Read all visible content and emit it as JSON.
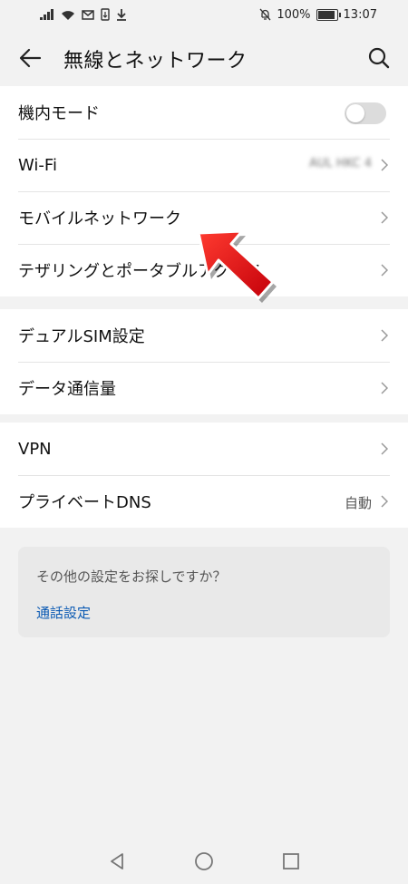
{
  "status_bar": {
    "battery_text": "100%",
    "time": "13:07",
    "battery_level": 1.0
  },
  "header": {
    "title": "無線とネットワーク"
  },
  "groups": [
    {
      "rows": [
        {
          "label": "機内モード",
          "type": "toggle",
          "toggle_on": false
        },
        {
          "label": "Wi-Fi",
          "type": "chevron",
          "value": "AUL HKC 4"
        },
        {
          "label": "モバイルネットワーク",
          "type": "chevron"
        },
        {
          "label": "テザリングとポータブルアクセス",
          "type": "chevron"
        }
      ]
    },
    {
      "rows": [
        {
          "label": "デュアルSIM設定",
          "type": "chevron"
        },
        {
          "label": "データ通信量",
          "type": "chevron"
        }
      ]
    },
    {
      "rows": [
        {
          "label": "VPN",
          "type": "chevron"
        },
        {
          "label": "プライベートDNS",
          "type": "chevron",
          "value": "自動"
        }
      ]
    }
  ],
  "more_card": {
    "question": "その他の設定をお探しですか？",
    "link": "通話設定"
  },
  "colors": {
    "link": "#0a59b3",
    "arrow": "#e8141a",
    "background": "#f2f2f2"
  },
  "icons": [
    "signal-icon",
    "wifi-icon",
    "mail-icon",
    "sim-icon",
    "download-icon",
    "alarm-off-icon",
    "battery-icon",
    "back-arrow-icon",
    "search-icon",
    "chevron-right-icon",
    "nav-back-icon",
    "nav-home-icon",
    "nav-recent-icon"
  ]
}
